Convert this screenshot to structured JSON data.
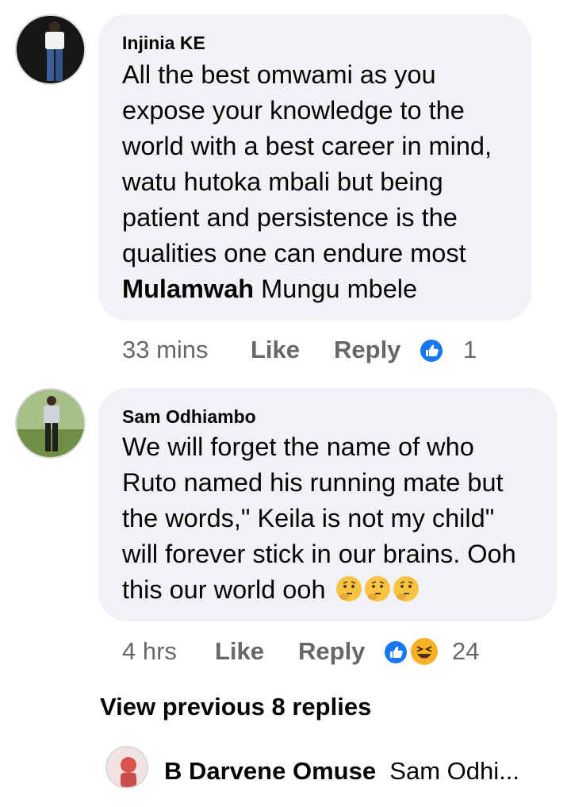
{
  "comments": [
    {
      "author": "Injinia KE",
      "text_lines": [
        "All the best omwami as you",
        "expose your knowledge to the",
        "world with a best career in mind,",
        "watu hutoka mbali but being",
        "patient and persistence is the",
        "qualities one can endure most"
      ],
      "mention": "Mulamwah",
      "mention_tail": " Mungu mbele",
      "time": "33 mins",
      "like_label": "Like",
      "reply_label": "Reply",
      "reaction_count": "1",
      "reactions": [
        "like-icon"
      ]
    },
    {
      "author": "Sam Odhiambo",
      "text_lines": [
        "We will forget the name of who",
        "Ruto named his running mate but",
        "the words,\" Keila is not my child\"",
        "will forever stick in our brains. Ooh"
      ],
      "last_line": "this our world ooh",
      "emojis": [
        "thinking-face-emoji",
        "thinking-face-emoji",
        "thinking-face-emoji"
      ],
      "time": "4 hrs",
      "like_label": "Like",
      "reply_label": "Reply",
      "reaction_count": "24",
      "reactions": [
        "like-icon",
        "haha-icon"
      ]
    }
  ],
  "view_previous": "View previous 8 replies",
  "reply_preview": {
    "author": "B Darvene Omuse",
    "text": "Sam Odhi..."
  },
  "colors": {
    "bubble": "#f0f2f5",
    "meta_text": "#65676b",
    "like_blue": "#1877f2",
    "haha_yellow": "#f7b125"
  }
}
